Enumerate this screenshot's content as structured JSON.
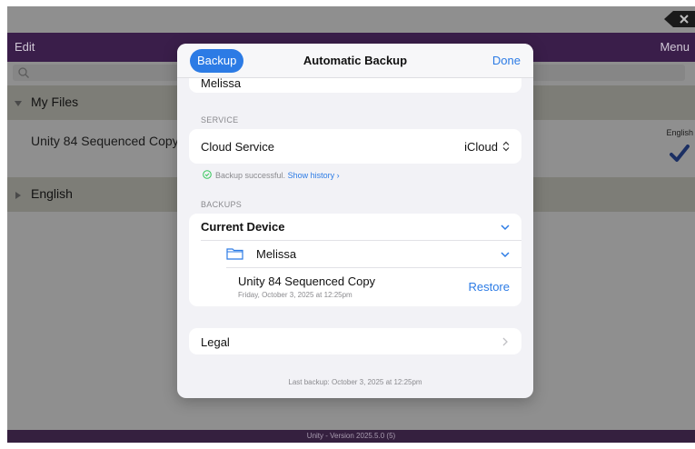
{
  "app": {
    "nav": {
      "edit": "Edit",
      "menu": "Menu"
    },
    "sections": [
      {
        "label": "My Files"
      },
      {
        "label": "English"
      }
    ],
    "file": {
      "title": "Unity 84 Sequenced Copy",
      "language": "English"
    },
    "footer": "Unity - Version 2025.5.0 (5)"
  },
  "modal": {
    "backup_button": "Backup",
    "title": "Automatic Backup",
    "done": "Done",
    "user_row": "Melissa",
    "service_label": "SERVICE",
    "cloud_service_label": "Cloud Service",
    "cloud_service_value": "iCloud",
    "status_text": "Backup successful.",
    "show_history": "Show history",
    "backups_label": "BACKUPS",
    "device": "Current Device",
    "folder": "Melissa",
    "backup_item": {
      "name": "Unity 84 Sequenced Copy",
      "date": "Friday, October 3, 2025 at 12:25pm",
      "restore": "Restore"
    },
    "legal": "Legal",
    "last_backup": "Last backup: October 3, 2025 at 12:25pm"
  },
  "colors": {
    "accent": "#2c7be5",
    "nav_bg": "#3a1e4a",
    "footer_bg": "#35203f",
    "overlay_bg": "#8f8f8f"
  }
}
